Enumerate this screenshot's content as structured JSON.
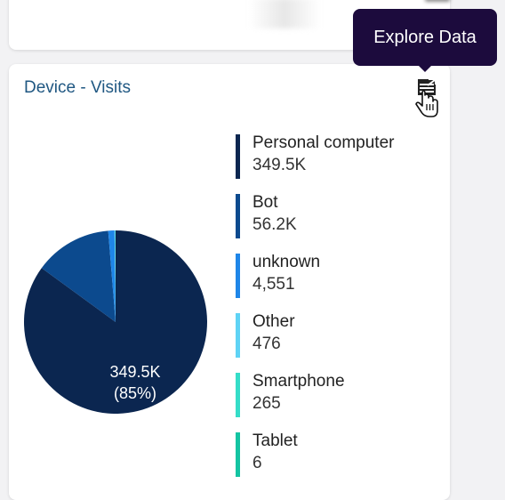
{
  "tooltip": {
    "text": "Explore Data"
  },
  "card": {
    "title": "Device - Visits"
  },
  "pie": {
    "center_label": {
      "value": "349.5K",
      "percent": "(85%)"
    }
  },
  "legend": [
    {
      "name": "Personal computer",
      "value": "349.5K",
      "color": "#0b2650"
    },
    {
      "name": "Bot",
      "value": "56.2K",
      "color": "#0c4a8e"
    },
    {
      "name": "unknown",
      "value": "4,551",
      "color": "#1f86e8"
    },
    {
      "name": "Other",
      "value": "476",
      "color": "#5fd3f5"
    },
    {
      "name": "Smartphone",
      "value": "265",
      "color": "#35ddc8"
    },
    {
      "name": "Tablet",
      "value": "6",
      "color": "#14c4a2"
    }
  ],
  "chart_data": {
    "type": "pie",
    "title": "Device - Visits",
    "labels": [
      "Personal computer",
      "Bot",
      "unknown",
      "Other",
      "Smartphone",
      "Tablet"
    ],
    "values": [
      349500,
      56200,
      4551,
      476,
      265,
      6
    ],
    "colors": [
      "#0b2650",
      "#0c4a8e",
      "#1f86e8",
      "#5fd3f5",
      "#35ddc8",
      "#14c4a2"
    ]
  }
}
